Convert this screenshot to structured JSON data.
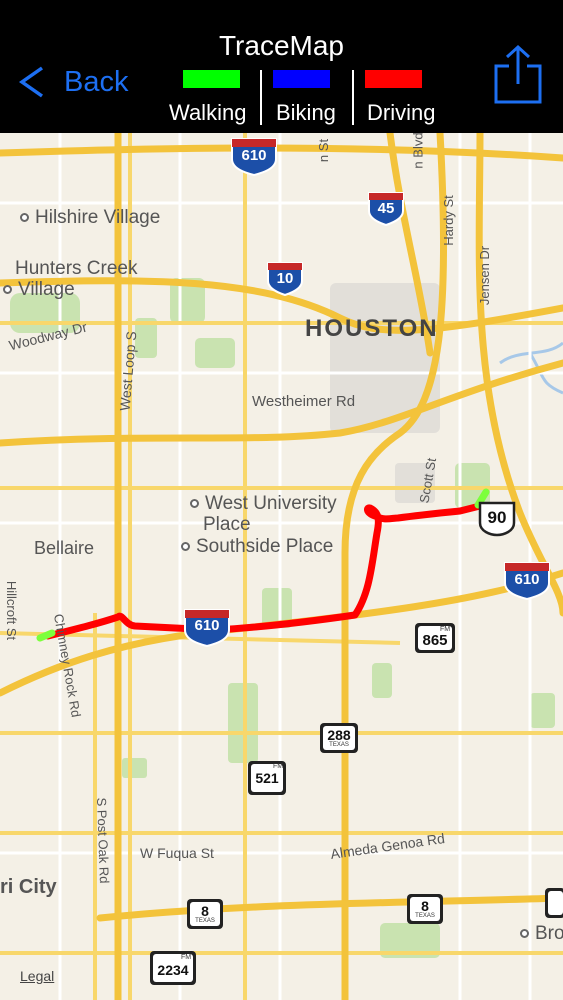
{
  "header": {
    "title": "TraceMap",
    "back_label": "Back"
  },
  "legend": [
    {
      "label": "Walking",
      "color": "#00ff00"
    },
    {
      "label": "Biking",
      "color": "#0000ff"
    },
    {
      "label": "Driving",
      "color": "#ff0000"
    }
  ],
  "map": {
    "city_label": "HOUSTON",
    "place_labels": {
      "hilshire_village": "Hilshire Village",
      "hunters_creek_line1": "Hunters Creek",
      "hunters_creek_line2": "Village",
      "west_university_line1": "West University",
      "west_university_line2": "Place",
      "southside_place": "Southside Place",
      "bellaire": "Bellaire",
      "west_loop": "West Loop S",
      "westheimer": "Westheimer Rd",
      "woodway": "Woodway Dr",
      "scott_st": "Scott St",
      "hardy_st": "Hardy St",
      "jensen_dr": "Jensen Dr",
      "hillcroft_st": "Hillcroft St",
      "chimney_rock": "Chimney Rock Rd",
      "post_oak": "S Post Oak Rd",
      "w_fuqua": "W Fuqua St",
      "almeda_genoa": "Almeda Genoa Rd",
      "ri_city": "ri City",
      "bro": "Bro",
      "main_blvd": "n Blvd",
      "n_st": "n St"
    },
    "shields": {
      "i610_top": "610",
      "i45": "45",
      "i10": "10",
      "i610_right": "610",
      "i610_route": "610",
      "us90": "90",
      "fm865": "865",
      "tx288": "288",
      "fm521": "521",
      "tx8_left": "8",
      "tx8_right": "8",
      "fm2234": "2234",
      "fm_tag": "FM",
      "texas_tag": "TEXAS"
    },
    "legal": "Legal"
  },
  "status": {
    "battery_color": "#4cd964"
  }
}
